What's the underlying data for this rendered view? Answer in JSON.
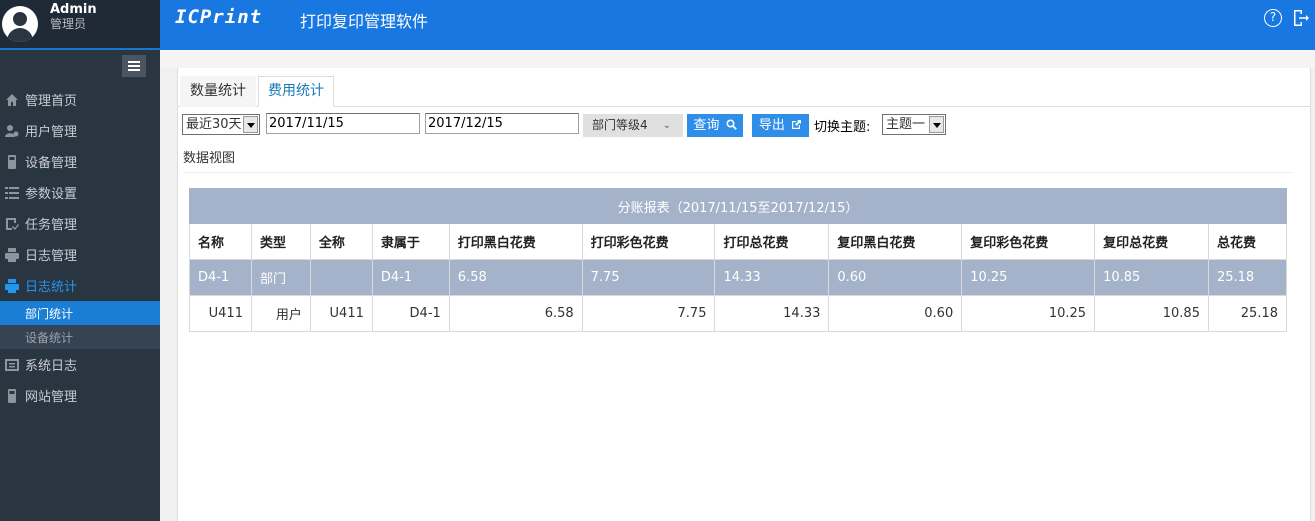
{
  "profile": {
    "name": "Admin",
    "role": "管理员"
  },
  "header": {
    "logo": "ICPrint",
    "title": "打印复印管理软件",
    "help_glyph": "?"
  },
  "sidebar": {
    "items": [
      {
        "label": "管理首页",
        "icon": "home-icon"
      },
      {
        "label": "用户管理",
        "icon": "users-icon"
      },
      {
        "label": "设备管理",
        "icon": "device-icon"
      },
      {
        "label": "参数设置",
        "icon": "list-icon"
      },
      {
        "label": "任务管理",
        "icon": "task-icon"
      },
      {
        "label": "日志管理",
        "icon": "printer-icon"
      },
      {
        "label": "日志统计",
        "icon": "stats-icon",
        "active": true
      },
      {
        "label": "系统日志",
        "icon": "syslog-icon"
      },
      {
        "label": "网站管理",
        "icon": "site-icon"
      }
    ],
    "sub_items": [
      {
        "label": "部门统计",
        "selected": true
      },
      {
        "label": "设备统计",
        "selected": false
      }
    ]
  },
  "tabs": [
    {
      "label": "数量统计",
      "active": false
    },
    {
      "label": "费用统计",
      "active": true
    }
  ],
  "filters": {
    "range_select": "最近30天",
    "start_date": "2017/11/15",
    "end_date": "2017/12/15",
    "dept_level": "部门等级4",
    "query_button": "查询",
    "export_button": "导出",
    "theme_label": "切换主题:",
    "theme_select": "主题一"
  },
  "data_view_label": "数据视图",
  "report": {
    "caption": "分账报表（2017/11/15至2017/12/15）",
    "columns": [
      "名称",
      "类型",
      "全称",
      "隶属于",
      "打印黑白花费",
      "打印彩色花费",
      "打印总花费",
      "复印黑白花费",
      "复印彩色花费",
      "复印总花费",
      "总花费"
    ],
    "rows": [
      {
        "kind": "dept",
        "cells": [
          "D4-1",
          "部门",
          "",
          "D4-1",
          "6.58",
          "7.75",
          "14.33",
          "0.60",
          "10.25",
          "10.85",
          "25.18"
        ]
      },
      {
        "kind": "user",
        "cells": [
          "U411",
          "用户",
          "U411",
          "D4-1",
          "6.58",
          "7.75",
          "14.33",
          "0.60",
          "10.25",
          "10.85",
          "25.18"
        ]
      }
    ]
  },
  "colors": {
    "accent": "#1877e0",
    "sidebar_bg": "#2a3542",
    "row_highlight": "#a4b3c9"
  }
}
